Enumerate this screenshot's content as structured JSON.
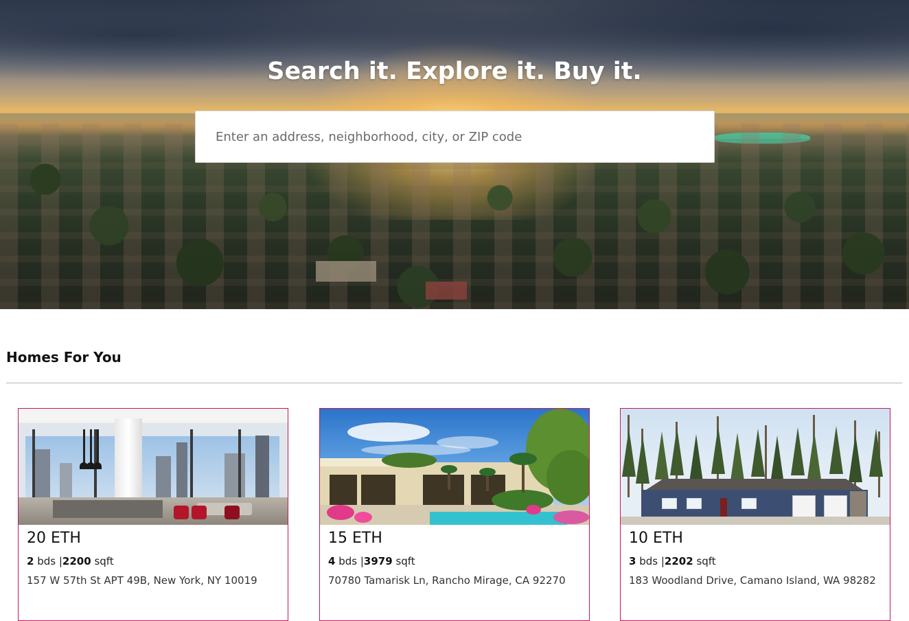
{
  "hero": {
    "title": "Search it. Explore it. Buy it.",
    "search_placeholder": "Enter an address, neighborhood, city, or ZIP code",
    "search_value": ""
  },
  "section": {
    "title": "Homes For You"
  },
  "listings": [
    {
      "price": "20 ETH",
      "beds": "2",
      "beds_unit": "bds",
      "separator": "|",
      "sqft": "2200",
      "sqft_unit": "sqft",
      "address": "157 W 57th St APT 49B, New York, NY 10019"
    },
    {
      "price": "15 ETH",
      "beds": "4",
      "beds_unit": "bds",
      "separator": "|",
      "sqft": "3979",
      "sqft_unit": "sqft",
      "address": "70780 Tamarisk Ln, Rancho Mirage, CA 92270"
    },
    {
      "price": "10 ETH",
      "beds": "3",
      "beds_unit": "bds",
      "separator": "|",
      "sqft": "2202",
      "sqft_unit": "sqft",
      "address": "183 Woodland Drive, Camano Island, WA 98282"
    }
  ],
  "colors": {
    "card_border": "#c2185b",
    "hero_text": "#ffffff"
  }
}
